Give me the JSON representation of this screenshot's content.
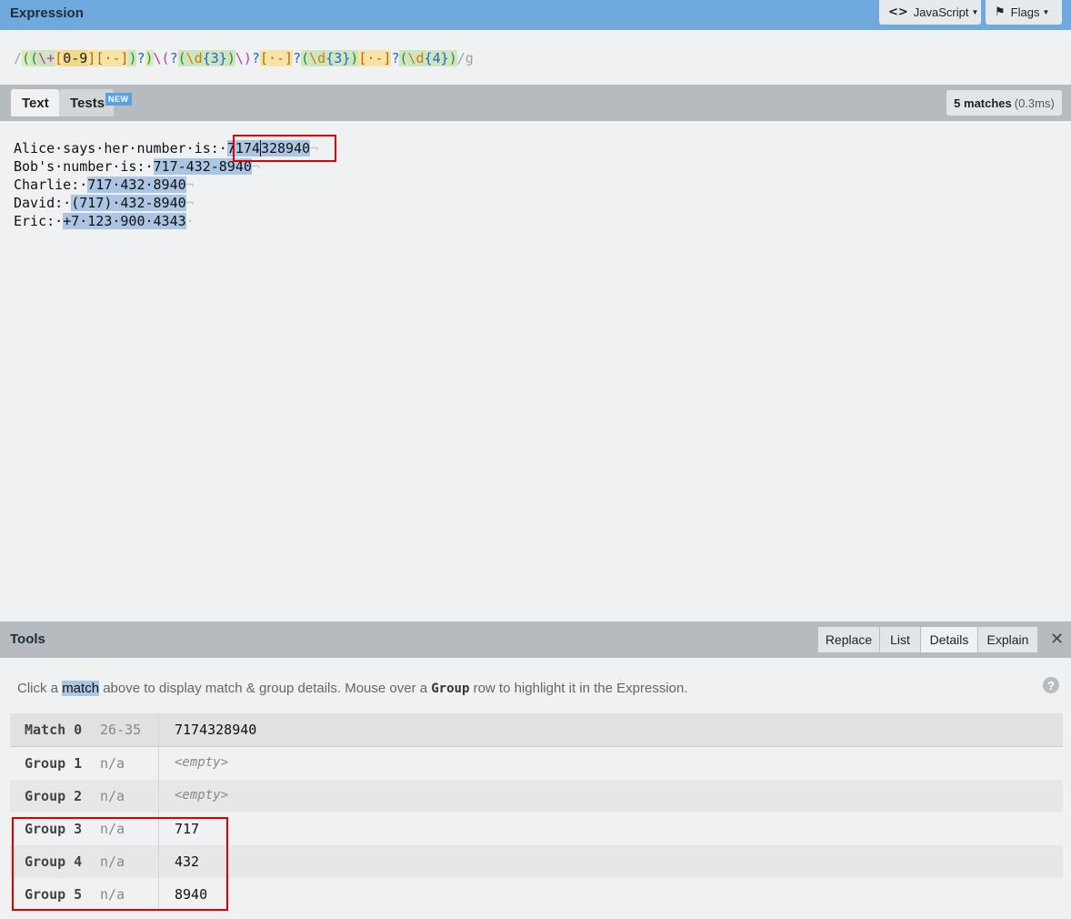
{
  "expression": {
    "title": "Expression",
    "language_button": "JavaScript",
    "flags_button": "Flags",
    "tokens": [
      "/",
      "(",
      "(",
      "\\+",
      "[",
      "0-9",
      "]",
      "[",
      "·-",
      "]",
      ")",
      "?",
      ")",
      "\\(",
      "?",
      "(",
      "\\d",
      "{3}",
      ")",
      "\\)",
      "?",
      "[",
      "·-",
      "]",
      "?",
      "(",
      "\\d",
      "{3}",
      ")",
      "[",
      "·-",
      "]",
      "?",
      "(",
      "\\d",
      "{4}",
      ")",
      "/g"
    ]
  },
  "tabs": {
    "text_label": "Text",
    "tests_label": "Tests",
    "new_badge": "NEW",
    "matches_count": "5 matches",
    "matches_time": "(0.3ms)"
  },
  "text_lines": [
    {
      "prefix": "Alice·says·her·number·is:·",
      "pre_match": "",
      "match": "7174328940",
      "suffix": "¬"
    },
    {
      "prefix": "Bob's·number·is:·",
      "pre_match": "",
      "match": "717-432-8940",
      "suffix": "¬"
    },
    {
      "prefix": "Charlie:·",
      "pre_match": "",
      "match": "717·432·8940",
      "suffix": "¬"
    },
    {
      "prefix": "David:·",
      "pre_match": "",
      "match": "(717)·432-8940",
      "suffix": "¬"
    },
    {
      "prefix": "Eric:·",
      "pre_match": "",
      "match": "+7·123·900·4343",
      "suffix": "·"
    }
  ],
  "tools": {
    "title": "Tools",
    "tabs": [
      "Replace",
      "List",
      "Details",
      "Explain"
    ],
    "active_tab": "Details",
    "info_before": "Click a ",
    "info_match": "match",
    "info_middle": " above to display match & group details. Mouse over a ",
    "info_group": "Group",
    "info_after": " row to highlight it in the Expression.",
    "rows": [
      {
        "label": "Match 0",
        "range": "26-35",
        "value": "7174328940",
        "empty": false
      },
      {
        "label": "Group 1",
        "range": "n/a",
        "value": "<empty>",
        "empty": true
      },
      {
        "label": "Group 2",
        "range": "n/a",
        "value": "<empty>",
        "empty": true
      },
      {
        "label": "Group 3",
        "range": "n/a",
        "value": "717",
        "empty": false
      },
      {
        "label": "Group 4",
        "range": "n/a",
        "value": "432",
        "empty": false
      },
      {
        "label": "Group 5",
        "range": "n/a",
        "value": "8940",
        "empty": false
      }
    ]
  }
}
